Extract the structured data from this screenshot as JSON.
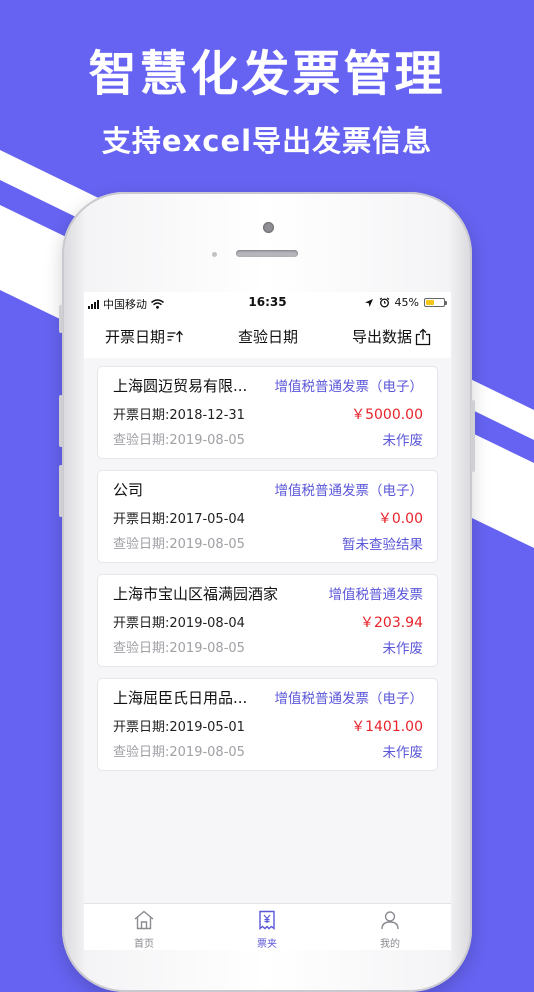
{
  "promo": {
    "headline": "智慧化发票管理",
    "subline": "支持excel导出发票信息"
  },
  "colors": {
    "background": "#6663f2",
    "accent": "#5b57d9",
    "amount": "#e8232a"
  },
  "statusbar": {
    "carrier": "中国移动",
    "time": "16:35",
    "battery": "45%",
    "battery_level": 0.45
  },
  "toolbar": {
    "issue_date_label": "开票日期",
    "check_date_label": "查验日期",
    "export_label": "导出数据"
  },
  "invoices": [
    {
      "company": "上海圆迈贸易有限...",
      "type": "增值税普通发票（电子）",
      "issue_date": "开票日期:2018-12-31",
      "amount": "￥5000.00",
      "check_date": "查验日期:2019-08-05",
      "status": "未作废"
    },
    {
      "company": "公司",
      "type": "增值税普通发票（电子）",
      "issue_date": "开票日期:2017-05-04",
      "amount": "￥0.00",
      "check_date": "查验日期:2019-08-05",
      "status": "暂未查验结果"
    },
    {
      "company": "上海市宝山区福满园酒家",
      "type": "增值税普通发票",
      "issue_date": "开票日期:2019-08-04",
      "amount": "￥203.94",
      "check_date": "查验日期:2019-08-05",
      "status": "未作废"
    },
    {
      "company": "上海屈臣氏日用品...",
      "type": "增值税普通发票（电子）",
      "issue_date": "开票日期:2019-05-01",
      "amount": "￥1401.00",
      "check_date": "查验日期:2019-08-05",
      "status": "未作废"
    }
  ],
  "tabbar": {
    "home": "首页",
    "invoices": "票夹",
    "mine": "我的",
    "active": "invoices"
  }
}
